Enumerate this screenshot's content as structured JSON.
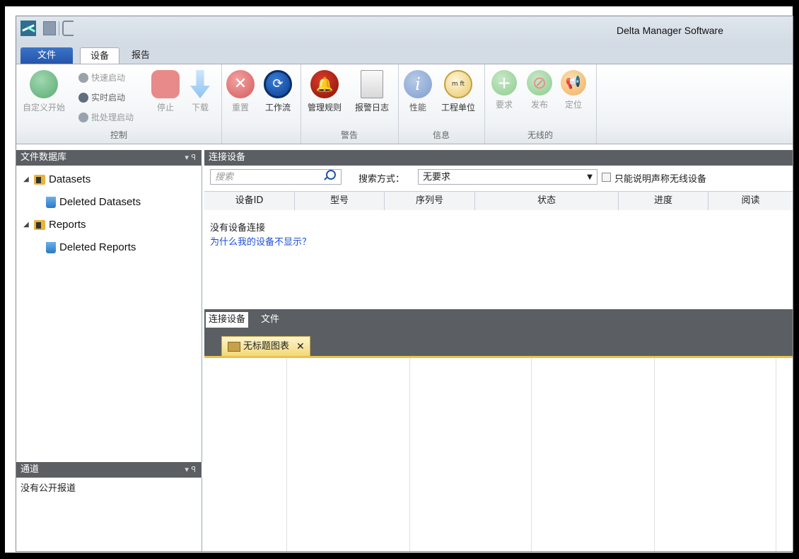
{
  "app": {
    "title": "Delta Manager Software"
  },
  "tabs": [
    {
      "label": "文件"
    },
    {
      "label": "设备"
    },
    {
      "label": "报告"
    }
  ],
  "ribbon": {
    "control": {
      "title": "控制",
      "custom_start": "自定义开始",
      "quick_start": "快速启动",
      "realtime_start": "实时启动",
      "batch_start": "批处理启动",
      "stop": "停止",
      "download": "下载"
    },
    "reset": "重置",
    "workflow": "工作流",
    "alarm": {
      "title": "警告",
      "rules": "管理规则",
      "log": "报警日志"
    },
    "info": {
      "title": "信息",
      "performance": "性能",
      "units": "工程单位",
      "units_glyph": "m ft"
    },
    "wireless": {
      "title": "无线的",
      "request": "要求",
      "publish": "发布",
      "locate": "定位"
    }
  },
  "file_db": {
    "title": "文件数据库",
    "pin": "▾ ꟼ",
    "items": [
      {
        "label": "Datasets"
      },
      {
        "label": "Deleted Datasets"
      },
      {
        "label": "Reports"
      },
      {
        "label": "Deleted Reports"
      }
    ]
  },
  "channels": {
    "title": "通道",
    "pin": "▾ ꟼ",
    "empty": "没有公开报道"
  },
  "connected": {
    "title": "连接设备",
    "search_placeholder": "搜索",
    "search_mode_label": "搜索方式：",
    "search_mode_value": "无要求",
    "wireless_only_label": "只能说明声称无线设备",
    "columns": [
      "设备ID",
      "型号",
      "序列号",
      "状态",
      "进度",
      "阅读"
    ],
    "empty_text": "没有设备连接",
    "why_link": "为什么我的设备不显示？"
  },
  "bottom_tabs": [
    {
      "label": "连接设备"
    },
    {
      "label": "文件"
    }
  ],
  "document_tab": {
    "label": "无标题图表",
    "close": "✕"
  }
}
